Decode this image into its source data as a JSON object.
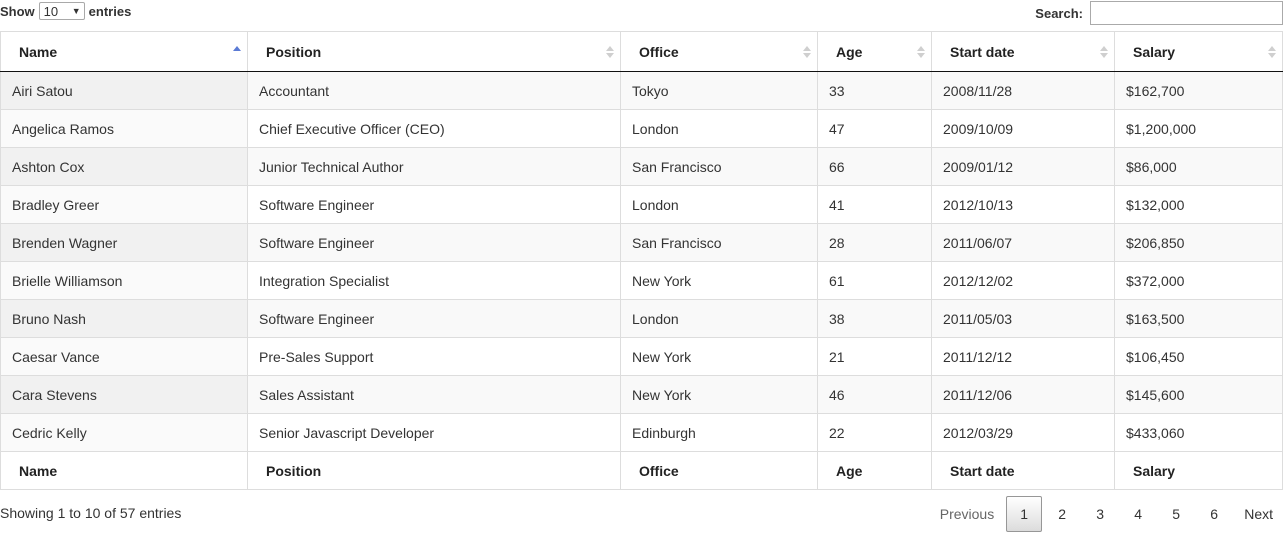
{
  "controls": {
    "show_label": "Show",
    "length_value": "10",
    "entries_label": "entries",
    "search_label": "Search:",
    "search_value": ""
  },
  "columns": [
    "Name",
    "Position",
    "Office",
    "Age",
    "Start date",
    "Salary"
  ],
  "sorted_column": "Name",
  "sort_direction": "ascending",
  "rows": [
    [
      "Airi Satou",
      "Accountant",
      "Tokyo",
      "33",
      "2008/11/28",
      "$162,700"
    ],
    [
      "Angelica Ramos",
      "Chief Executive Officer (CEO)",
      "London",
      "47",
      "2009/10/09",
      "$1,200,000"
    ],
    [
      "Ashton Cox",
      "Junior Technical Author",
      "San Francisco",
      "66",
      "2009/01/12",
      "$86,000"
    ],
    [
      "Bradley Greer",
      "Software Engineer",
      "London",
      "41",
      "2012/10/13",
      "$132,000"
    ],
    [
      "Brenden Wagner",
      "Software Engineer",
      "San Francisco",
      "28",
      "2011/06/07",
      "$206,850"
    ],
    [
      "Brielle Williamson",
      "Integration Specialist",
      "New York",
      "61",
      "2012/12/02",
      "$372,000"
    ],
    [
      "Bruno Nash",
      "Software Engineer",
      "London",
      "38",
      "2011/05/03",
      "$163,500"
    ],
    [
      "Caesar Vance",
      "Pre-Sales Support",
      "New York",
      "21",
      "2011/12/12",
      "$106,450"
    ],
    [
      "Cara Stevens",
      "Sales Assistant",
      "New York",
      "46",
      "2011/12/06",
      "$145,600"
    ],
    [
      "Cedric Kelly",
      "Senior Javascript Developer",
      "Edinburgh",
      "22",
      "2012/03/29",
      "$433,060"
    ]
  ],
  "info": "Showing 1 to 10 of 57 entries",
  "pagination": {
    "previous": "Previous",
    "pages": [
      "1",
      "2",
      "3",
      "4",
      "5",
      "6"
    ],
    "current": "1",
    "next": "Next"
  },
  "colors": {
    "sort_active": "#5b7bd5",
    "sort_inactive": "#cfcfcf",
    "row_odd": "#f9f9f9",
    "row_even": "#ffffff"
  }
}
